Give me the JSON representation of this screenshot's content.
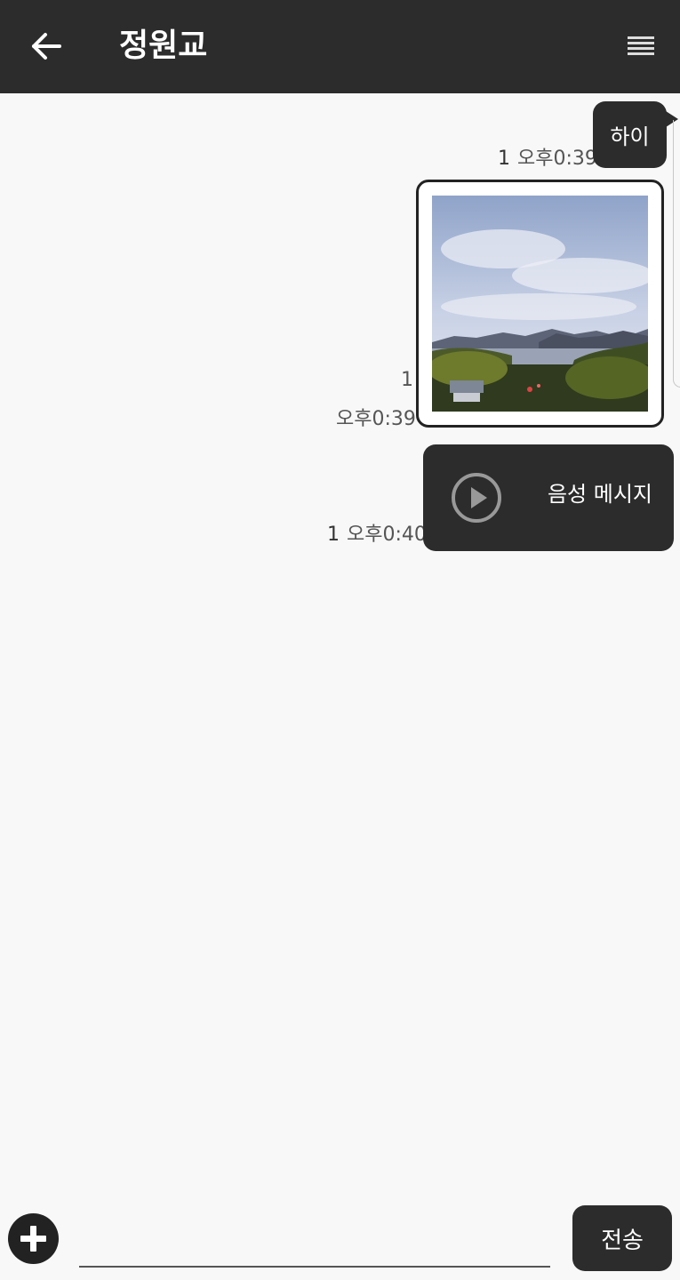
{
  "header": {
    "back_icon": "arrow-left-icon",
    "title": "정원교",
    "menu_icon": "menu-lines-icon",
    "background": "#2c2c2c"
  },
  "messages": [
    {
      "type": "text",
      "text": "하이",
      "unread": "1",
      "time": "오후0:39"
    },
    {
      "type": "image",
      "image": "landscape-photo",
      "unread": "1",
      "time": "오후0:39"
    },
    {
      "type": "voice",
      "icon": "play-circle-icon",
      "label": "음성 메시지",
      "unread": "1",
      "time": "오후0:40"
    }
  ],
  "input": {
    "plus_icon": "plus-circle-icon",
    "value": "",
    "send_label": "전송"
  }
}
